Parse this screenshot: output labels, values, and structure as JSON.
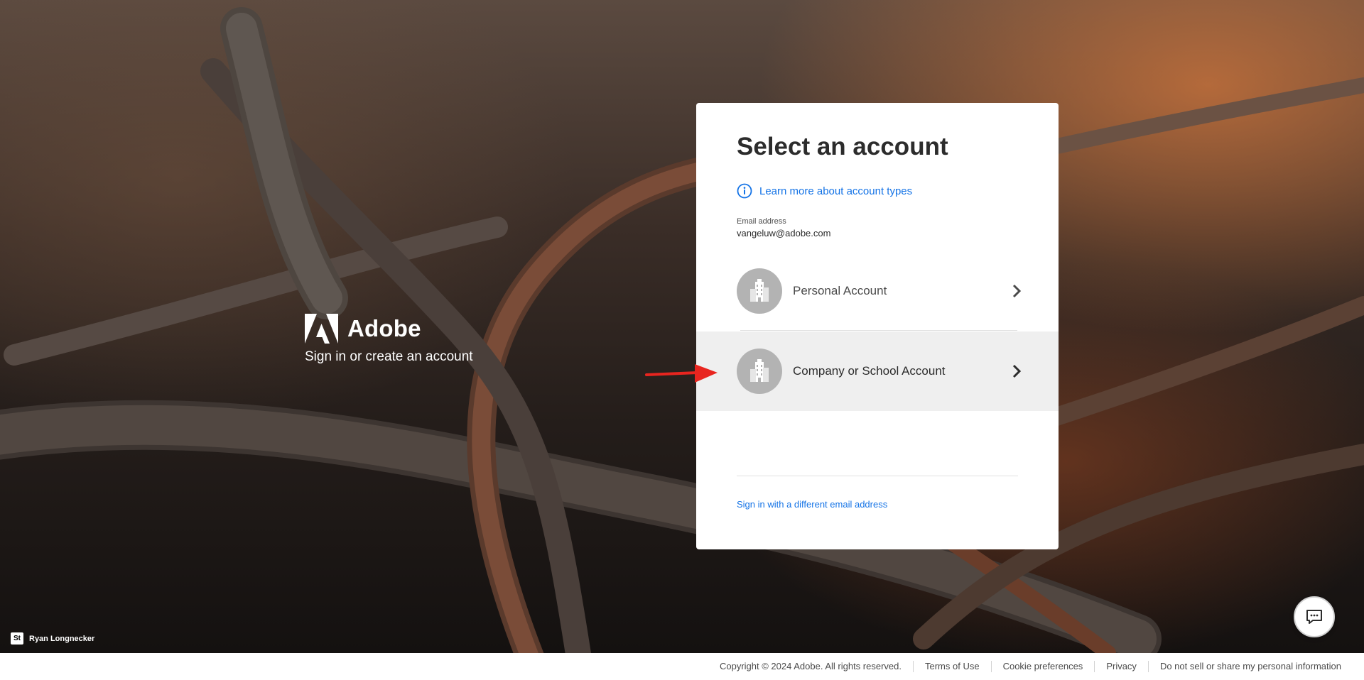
{
  "brand": {
    "name": "Adobe",
    "subtitle": "Sign in or create an account"
  },
  "card": {
    "title": "Select an account",
    "learn_more": "Learn more about account types",
    "email_label": "Email address",
    "email_value": "vangeluw@adobe.com",
    "accounts": [
      {
        "label": "Personal Account",
        "icon": "building-icon"
      },
      {
        "label": "Company or School Account",
        "icon": "building-icon"
      }
    ],
    "different_email": "Sign in with a different email address"
  },
  "photo_credit": {
    "badge": "St",
    "name": "Ryan Longnecker"
  },
  "footer": {
    "copyright": "Copyright © 2024 Adobe. All rights reserved.",
    "links": [
      "Terms of Use",
      "Cookie preferences",
      "Privacy",
      "Do not sell or share my personal information"
    ]
  },
  "colors": {
    "accent_blue": "#1473e6",
    "annotation_red": "#e8251f"
  }
}
